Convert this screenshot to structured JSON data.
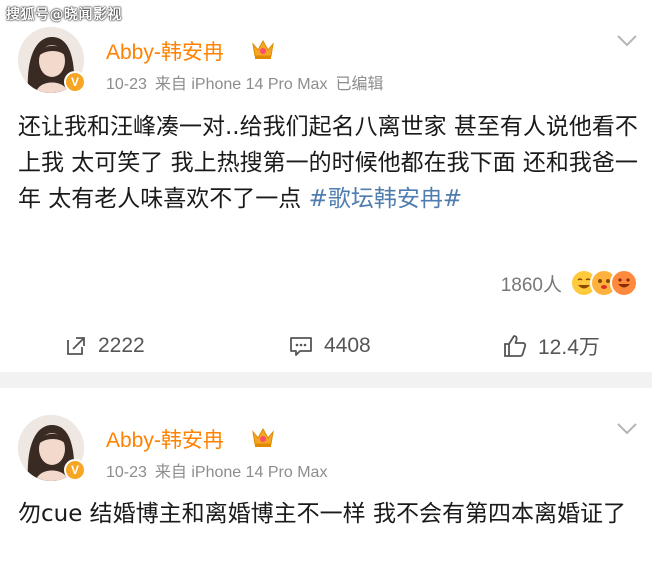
{
  "watermark": "搜狐号@晓闻影视",
  "posts": [
    {
      "author": "Abby-韩安冉",
      "date": "10-23",
      "source": "来自 iPhone 14 Pro Max",
      "edited": "已编辑",
      "text": "还让我和汪峰凑一对..给我们起名八离世家 甚至有人说他看不上我 太可笑了 我上热搜第一的时候他都在我下面 还和我爸一年 太有老人味喜欢不了一点 ",
      "hashtag": "#歌坛韩安冉#",
      "reaction_count": "1860人",
      "repost_count": "2222",
      "comment_count": "4408",
      "like_count": "12.4万"
    },
    {
      "author": "Abby-韩安冉",
      "date": "10-23",
      "source": "来自 iPhone 14 Pro Max",
      "text": "勿cue 结婚博主和离婚博主不一样 我不会有第四本离婚证了"
    }
  ],
  "colors": {
    "author": "#ff8200",
    "hashtag": "#507daf",
    "verified": "#f6a623",
    "divider": "#f2f2f2"
  },
  "icons": [
    "crown-icon",
    "verified-v-icon",
    "chevron-down-icon",
    "repost-icon",
    "comment-icon",
    "thumbs-up-icon",
    "emoji-reaction-icon"
  ]
}
